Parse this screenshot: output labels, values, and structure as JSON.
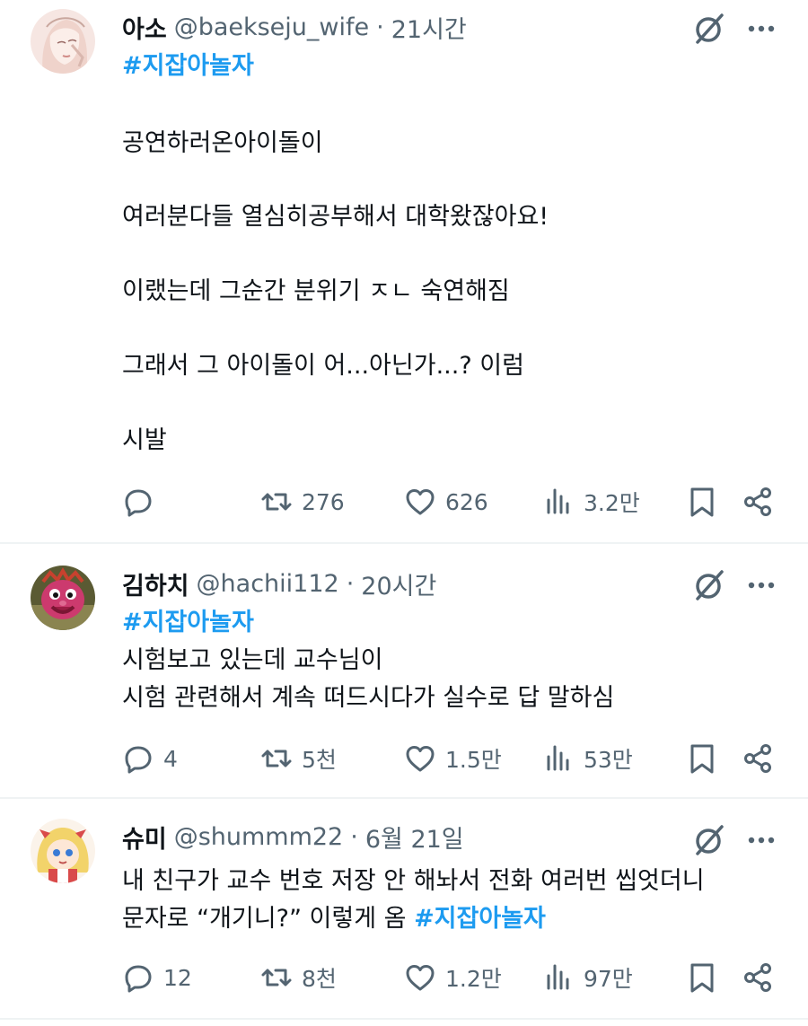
{
  "colors": {
    "accent": "#1d9bf0",
    "text": "#0f1419",
    "muted": "#536471",
    "divider": "#eff3f4"
  },
  "icons": {
    "reply": "speech-bubble-icon",
    "retweet": "retweet-arrows-icon",
    "like": "heart-icon",
    "views": "bar-chart-icon",
    "bookmark": "bookmark-icon",
    "share": "share-nodes-icon",
    "grok": "grok-slash-circle-icon",
    "more": "three-dots-icon"
  },
  "tweets": [
    {
      "name": "아소",
      "handle": "@baekseju_wife",
      "separator": "·",
      "time": "21시간",
      "hashtag": "#지잡아놀자",
      "lines": [
        "공연하러온아이돌이",
        "여러분다들 열심히공부해서 대학왔잖아요!",
        "이랬는데 그순간 분위기 ㅈㄴ 숙연해짐",
        "그래서 그 아이돌이 어...아닌가...? 이럼",
        "시발"
      ],
      "counts": {
        "reply": "",
        "retweet": "276",
        "like": "626",
        "views": "3.2만"
      }
    },
    {
      "name": "김하치",
      "handle": "@hachii112",
      "separator": "·",
      "time": "20시간",
      "hashtag": "#지잡아놀자",
      "lines": [
        "시험보고 있는데 교수님이",
        "시험 관련해서 계속 떠드시다가 실수로 답 말하심"
      ],
      "counts": {
        "reply": "4",
        "retweet": "5천",
        "like": "1.5만",
        "views": "53만"
      }
    },
    {
      "name": "슈미",
      "handle": "@shummm22",
      "separator": "·",
      "time": "6월 21일",
      "hashtag": "#지잡아놀자",
      "lines": [
        "내 친구가 교수 번호 저장 안 해놔서 전화 여러번 씹엇더니",
        "문자로 “개기니?” 이렇게 옴"
      ],
      "counts": {
        "reply": "12",
        "retweet": "8천",
        "like": "1.2만",
        "views": "97만"
      }
    }
  ]
}
